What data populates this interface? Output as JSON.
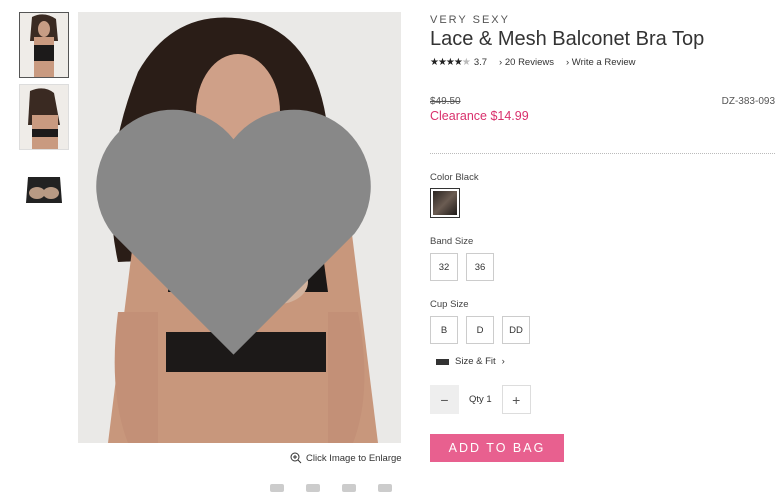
{
  "product": {
    "brand": "VERY SEXY",
    "title": "Lace & Mesh Balconet Bra Top",
    "rating": "3.7",
    "reviews_link": "20 Reviews",
    "write_review_link": "Write a Review",
    "original_price": "$49.50",
    "sale_price": "Clearance $14.99",
    "sku": "DZ-383-093",
    "rating_stars": 4
  },
  "color": {
    "label": "Color Black"
  },
  "band_size": {
    "label": "Band Size",
    "options": [
      "32",
      "36"
    ]
  },
  "cup_size": {
    "label": "Cup Size",
    "options": [
      "B",
      "D",
      "DD"
    ]
  },
  "size_fit": {
    "label": "Size & Fit"
  },
  "quantity": {
    "label": "Qty",
    "value": "1",
    "minus": "−",
    "plus": "+"
  },
  "add_to_bag": "ADD TO BAG",
  "enlarge_text": "Click Image to Enlarge",
  "accent_color": "#e8608f",
  "sale_color": "#d9306c"
}
